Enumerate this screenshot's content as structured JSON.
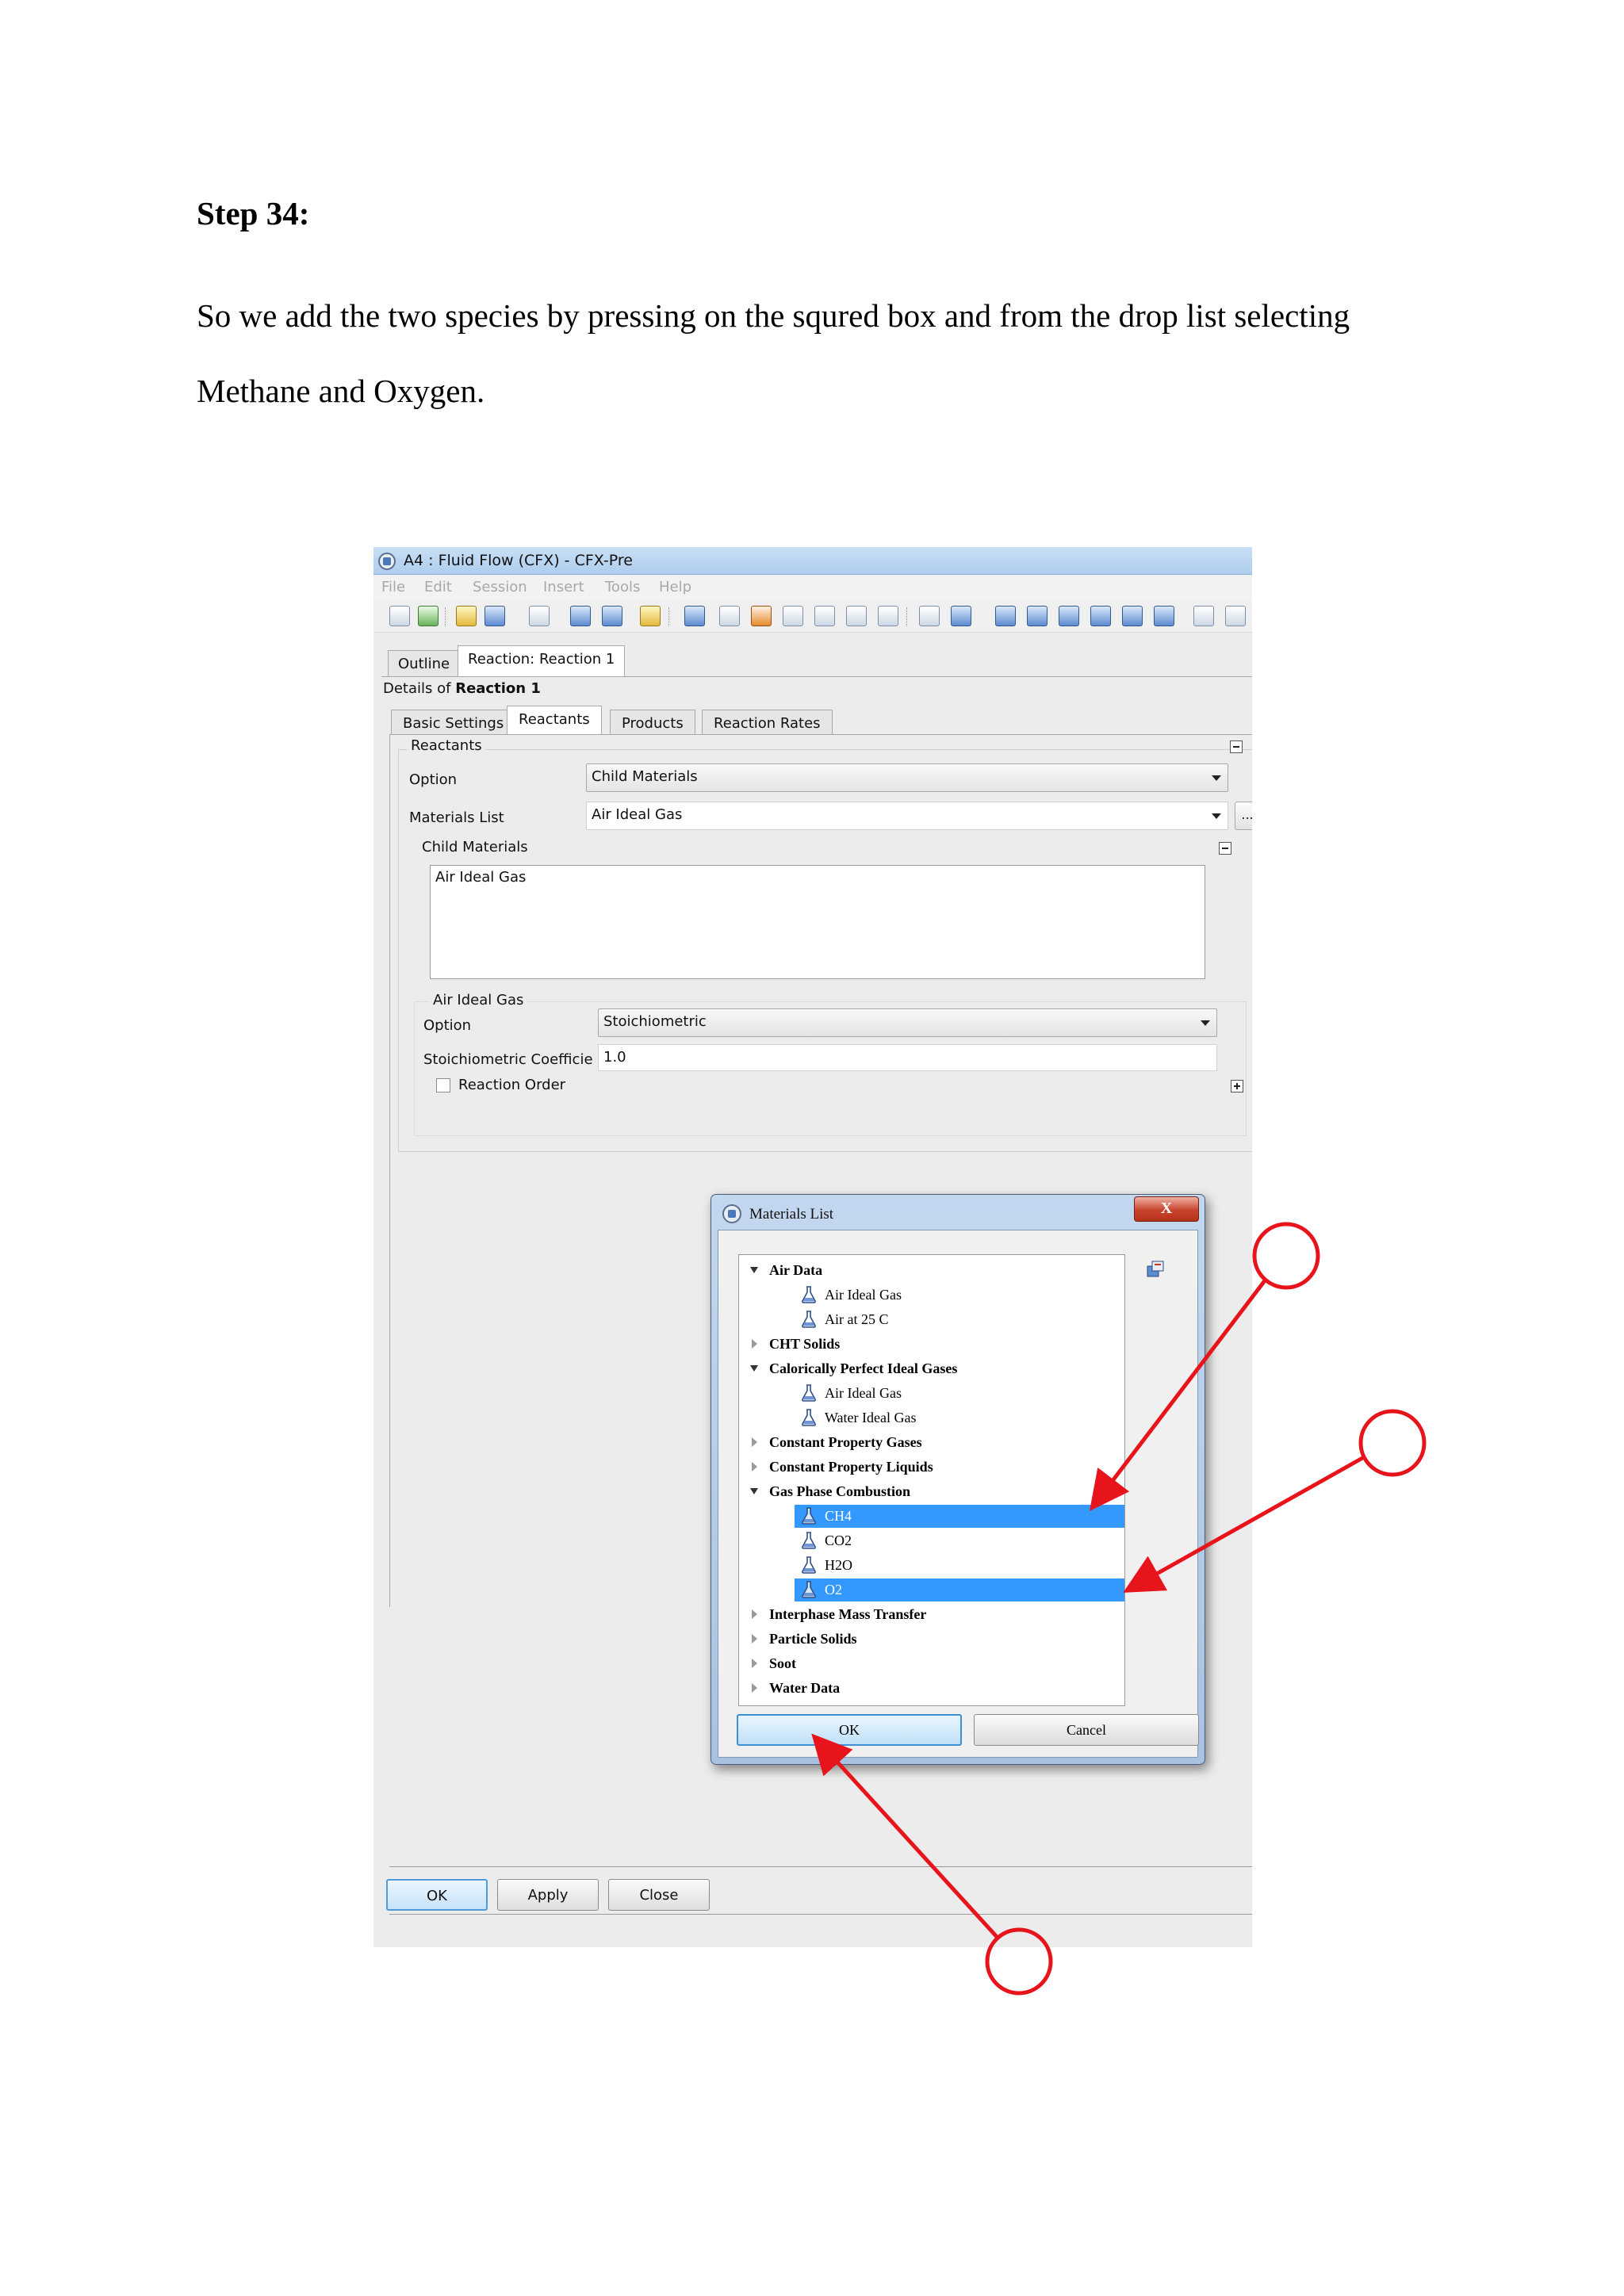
{
  "document": {
    "step_heading": "Step 34:",
    "paragraph_line1": "So we add the two species by pressing on the squred box and from the drop list selecting",
    "paragraph_line2": "Methane and Oxygen."
  },
  "window": {
    "title": "A4 : Fluid Flow (CFX) - CFX-Pre",
    "menu": [
      "File",
      "Edit",
      "Session",
      "Insert",
      "Tools",
      "Help"
    ]
  },
  "outline_tabs": [
    "Outline",
    "Reaction: Reaction 1"
  ],
  "details": {
    "prefix": "Details of",
    "name": "Reaction 1"
  },
  "sub_tabs": [
    "Basic Settings",
    "Reactants",
    "Products",
    "Reaction Rates"
  ],
  "reactants": {
    "group_label": "Reactants",
    "option_label": "Option",
    "option_value": "Child Materials",
    "materials_list_label": "Materials List",
    "materials_list_value": "Air Ideal Gas",
    "dots_label": "...",
    "child_materials_label": "Child Materials",
    "child_materials_items": [
      "Air Ideal Gas"
    ],
    "sub_group_label": "Air Ideal Gas",
    "sub_option_label": "Option",
    "sub_option_value": "Stoichiometric",
    "stoich_label": "Stoichiometric Coefficie",
    "stoich_value": "1.0",
    "reaction_order_label": "Reaction Order"
  },
  "bottom_buttons": {
    "ok": "OK",
    "apply": "Apply",
    "close": "Close"
  },
  "dialog": {
    "title": "Materials List",
    "close_glyph": "X",
    "tree": [
      {
        "kind": "cat",
        "label": "Air Data",
        "open": true
      },
      {
        "kind": "leaf",
        "label": "Air Ideal Gas"
      },
      {
        "kind": "leaf",
        "label": "Air at 25 C"
      },
      {
        "kind": "cat",
        "label": "CHT Solids",
        "open": false
      },
      {
        "kind": "cat",
        "label": "Calorically Perfect Ideal Gases",
        "open": true
      },
      {
        "kind": "leaf",
        "label": "Air Ideal Gas"
      },
      {
        "kind": "leaf",
        "label": "Water Ideal Gas"
      },
      {
        "kind": "cat",
        "label": "Constant Property Gases",
        "open": false
      },
      {
        "kind": "cat",
        "label": "Constant Property Liquids",
        "open": false
      },
      {
        "kind": "cat",
        "label": "Gas Phase Combustion",
        "open": true
      },
      {
        "kind": "leaf",
        "label": "CH4",
        "selected": true
      },
      {
        "kind": "leaf",
        "label": "CO2"
      },
      {
        "kind": "leaf",
        "label": "H2O"
      },
      {
        "kind": "leaf",
        "label": "O2",
        "selected": true
      },
      {
        "kind": "cat",
        "label": "Interphase Mass Transfer",
        "open": false
      },
      {
        "kind": "cat",
        "label": "Particle Solids",
        "open": false
      },
      {
        "kind": "cat",
        "label": "Soot",
        "open": false
      },
      {
        "kind": "cat",
        "label": "Water Data",
        "open": false
      }
    ],
    "ok_label": "OK",
    "cancel_label": "Cancel"
  },
  "colors": {
    "annotation": "#e8141c",
    "selection": "#3399ff"
  }
}
